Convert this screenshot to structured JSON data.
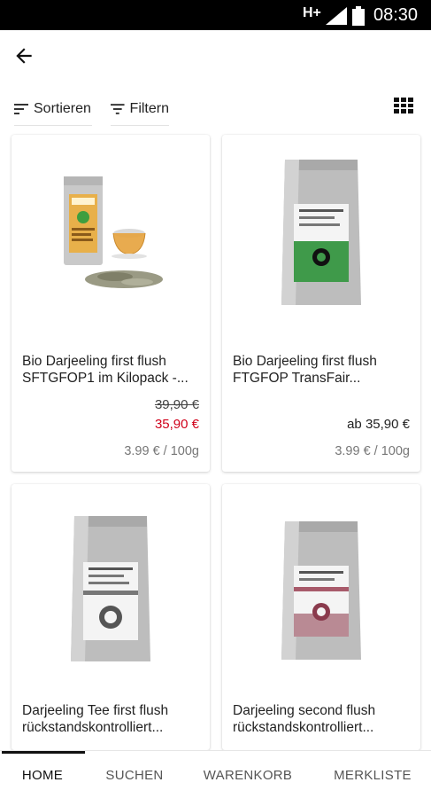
{
  "status_bar": {
    "network": "H+",
    "time": "08:30",
    "icons": [
      "signal-icon",
      "battery-icon"
    ]
  },
  "header": {
    "back_icon": "arrow-back-icon"
  },
  "toolbar": {
    "sort_label": "Sortieren",
    "filter_label": "Filtern",
    "sort_icon": "sort-icon",
    "filter_icon": "filter-icon",
    "view_icon": "grid-view-icon"
  },
  "products": [
    {
      "name": "Bio Darjeeling first flush SFTGFOP1 im Kilopack -...",
      "old_price": "39,90 €",
      "price": "35,90 €",
      "unit_price": "3.99 € / 100g"
    },
    {
      "name": "Bio Darjeeling first flush FTGFOP TransFair...",
      "price": "ab 35,90 €",
      "unit_price": "3.99 € / 100g"
    },
    {
      "name": "Darjeeling Tee first flush rückstandskontrolliert..."
    },
    {
      "name": "Darjeeling second flush rückstandskontrolliert..."
    }
  ],
  "bottom_nav": {
    "items": [
      {
        "label": "HOME"
      },
      {
        "label": "SUCHEN"
      },
      {
        "label": "WARENKORB"
      },
      {
        "label": "MERKLISTE"
      }
    ],
    "active": "HOME"
  },
  "colors": {
    "sale": "#d0021b",
    "text": "#222222",
    "muted": "#777777"
  }
}
